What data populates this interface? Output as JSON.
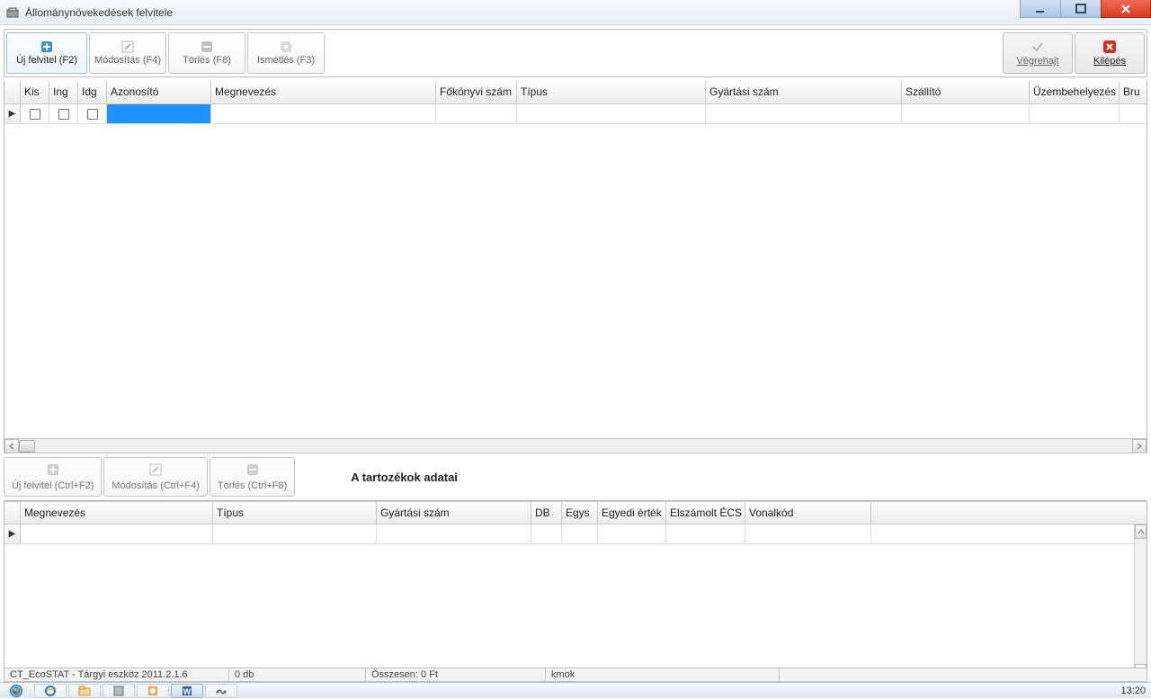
{
  "titlebar": {
    "title": "Állománynövekedések felvitele"
  },
  "toolbar": {
    "new_label": "Új felvitel (F2)",
    "edit_label": "Módosítás (F4)",
    "del_label": "Törlés (F8)",
    "repeat_label": "Ismétlés (F3)",
    "execute_label": "Végrehajt",
    "exit_label": "Kilépés"
  },
  "grid": {
    "headers": {
      "kis": "Kis",
      "ing": "Ing",
      "idg": "Idg",
      "azonosito": "Azonosító",
      "megnevezes": "Megnevezés",
      "fkszam": "Főkönyvi szám",
      "tipus": "Típus",
      "gyszam": "Gyártási szám",
      "szallito": "Szállító",
      "uzembe": "Üzembehelyezés",
      "brutto": "Bru"
    }
  },
  "detail": {
    "new_label": "Új felvitel (Ctrl+F2)",
    "edit_label": "Módosítás (Ctrl+F4)",
    "del_label": "Törlés (Ctrl+F8)",
    "title": "A tartozékok adatai",
    "headers": {
      "megnevezes": "Megnevezés",
      "tipus": "Típus",
      "gyszam": "Gyártási szám",
      "db": "DB",
      "egys": "Egys",
      "egyedi": "Egyedi érték",
      "ecs": "Elszámolt ÉCS",
      "vonalkod": "Vonalkód"
    }
  },
  "status": {
    "app": "CT_EcoSTAT - Tárgyi eszköz 2011.2.1.6",
    "count": "0 db",
    "sum": "Összesen: 0 Ft",
    "user": "kmok"
  },
  "taskbar": {
    "clock": "13:20"
  }
}
